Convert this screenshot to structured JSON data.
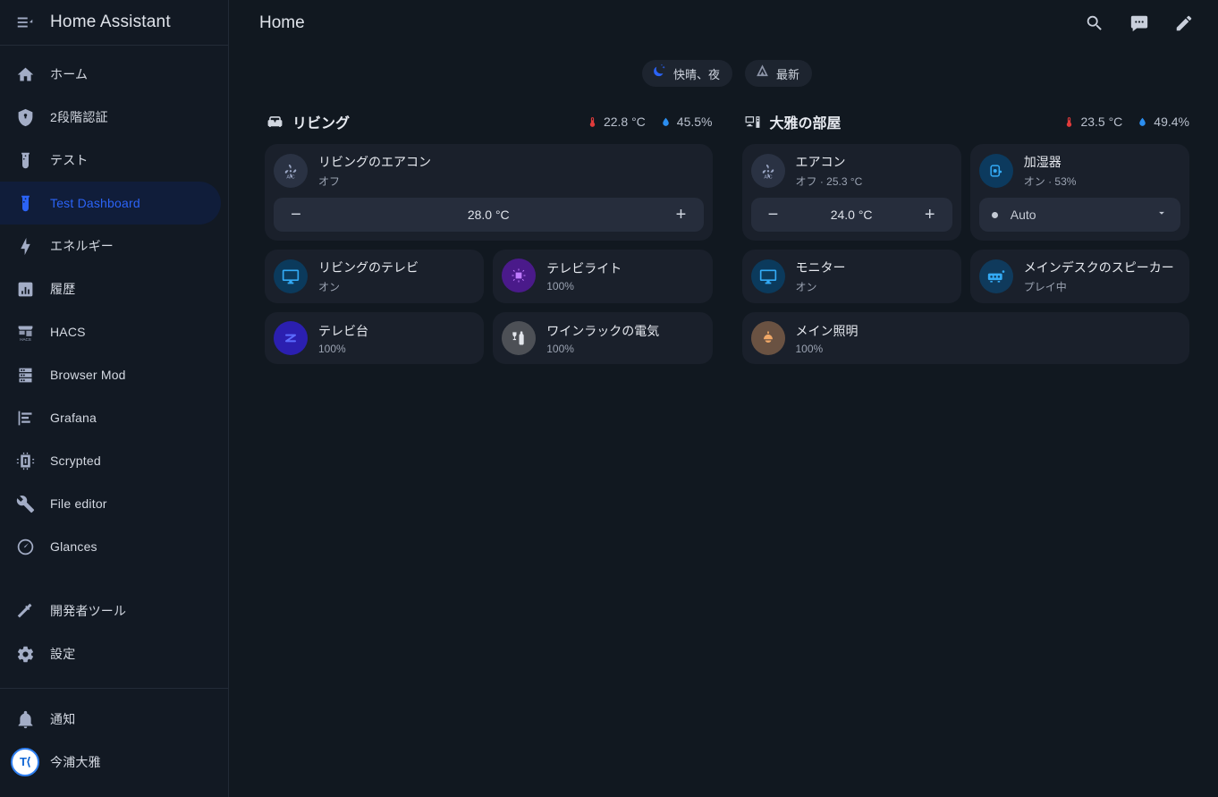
{
  "sidebar": {
    "title": "Home Assistant",
    "menu_icon": "menu-open-icon",
    "items": [
      {
        "label": "ホーム",
        "icon": "home-icon",
        "active": false
      },
      {
        "label": "2段階認証",
        "icon": "shield-lock-icon",
        "active": false
      },
      {
        "label": "テスト",
        "icon": "test-tube-icon",
        "active": false
      },
      {
        "label": "Test Dashboard",
        "icon": "test-tube-icon",
        "active": true
      },
      {
        "label": "エネルギー",
        "icon": "lightning-bolt-icon",
        "active": false
      },
      {
        "label": "履歴",
        "icon": "chart-box-icon",
        "active": false
      },
      {
        "label": "HACS",
        "icon": "hacs-storefront-icon",
        "active": false
      },
      {
        "label": "Browser Mod",
        "icon": "server-rack-icon",
        "active": false
      },
      {
        "label": "Grafana",
        "icon": "grafana-chart-icon",
        "active": false
      },
      {
        "label": "Scrypted",
        "icon": "chip-icon",
        "active": false
      },
      {
        "label": "File editor",
        "icon": "wrench-icon",
        "active": false
      },
      {
        "label": "Glances",
        "icon": "gauge-icon",
        "active": false
      }
    ],
    "bottom_items": [
      {
        "label": "開発者ツール",
        "icon": "hammer-icon"
      },
      {
        "label": "設定",
        "icon": "gear-icon"
      }
    ],
    "footer_items": [
      {
        "label": "通知",
        "icon": "bell-icon"
      },
      {
        "label": "今浦大雅",
        "icon": "avatar",
        "avatar_text": "T⟨"
      }
    ],
    "accent_color": "#2b63f6",
    "active_bg": "#101d3a"
  },
  "topbar": {
    "title": "Home",
    "actions": [
      {
        "name": "search-icon",
        "label": "Search"
      },
      {
        "name": "assist-icon",
        "label": "Assist"
      },
      {
        "name": "edit-pencil-icon",
        "label": "Edit dashboard"
      }
    ]
  },
  "chips": [
    {
      "label": "快晴、夜",
      "icon": "weather-night-icon",
      "icon_color": "#2b63f6"
    },
    {
      "label": "最新",
      "icon": "update-icon",
      "icon_color": "#8b93a6"
    }
  ],
  "areas": [
    {
      "name": "リビング",
      "icon": "sofa-icon",
      "sensors": [
        {
          "icon": "thermometer-icon",
          "color": "#e03b3b",
          "value": "22.8 °C"
        },
        {
          "icon": "water-drop-icon",
          "color": "#2b8ef0",
          "value": "45.5%"
        }
      ],
      "cards": [
        {
          "name": "リビングのエアコン",
          "state": "オフ",
          "icon": "ac-fan-icon",
          "badge_class": "badge-ac",
          "width": "wide",
          "control": {
            "type": "stepper",
            "value": "28.0 °C",
            "minus": "−",
            "plus": "+"
          }
        },
        {
          "name": "リビングのテレビ",
          "state": "オン",
          "icon": "television-icon",
          "badge_class": "badge-tv",
          "width": "half"
        },
        {
          "name": "テレビライト",
          "state": "100%",
          "icon": "led-strip-icon",
          "badge_class": "badge-tvlight",
          "width": "half"
        },
        {
          "name": "テレビ台",
          "state": "100%",
          "icon": "led-zigzag-icon",
          "badge_class": "badge-tvstand",
          "width": "half"
        },
        {
          "name": "ワインラックの電気",
          "state": "100%",
          "icon": "wine-bottle-icon",
          "badge_class": "badge-wine",
          "width": "half"
        }
      ]
    },
    {
      "name": "大雅の部屋",
      "icon": "desktop-tower-monitor-icon",
      "sensors": [
        {
          "icon": "thermometer-icon",
          "color": "#e03b3b",
          "value": "23.5 °C"
        },
        {
          "icon": "water-drop-icon",
          "color": "#2b8ef0",
          "value": "49.4%"
        }
      ],
      "cards": [
        {
          "name": "エアコン",
          "state": "オフ · 25.3 °C",
          "icon": "ac-fan-icon",
          "badge_class": "badge-ac",
          "width": "half",
          "control": {
            "type": "stepper",
            "value": "24.0 °C",
            "minus": "−",
            "plus": "+"
          }
        },
        {
          "name": "加湿器",
          "state": "オン · 53%",
          "icon": "humidifier-icon",
          "badge_class": "badge-humid",
          "width": "half",
          "control": {
            "type": "select",
            "value": "Auto"
          }
        },
        {
          "name": "モニター",
          "state": "オン",
          "icon": "television-icon",
          "badge_class": "badge-tv",
          "width": "half"
        },
        {
          "name": "メインデスクのスピーカー",
          "state": "プレイ中",
          "icon": "speaker-icon",
          "badge_class": "badge-speaker",
          "width": "half"
        },
        {
          "name": "メイン照明",
          "state": "100%",
          "icon": "ceiling-light-icon",
          "badge_class": "badge-mainlt",
          "width": "wide"
        }
      ]
    }
  ]
}
